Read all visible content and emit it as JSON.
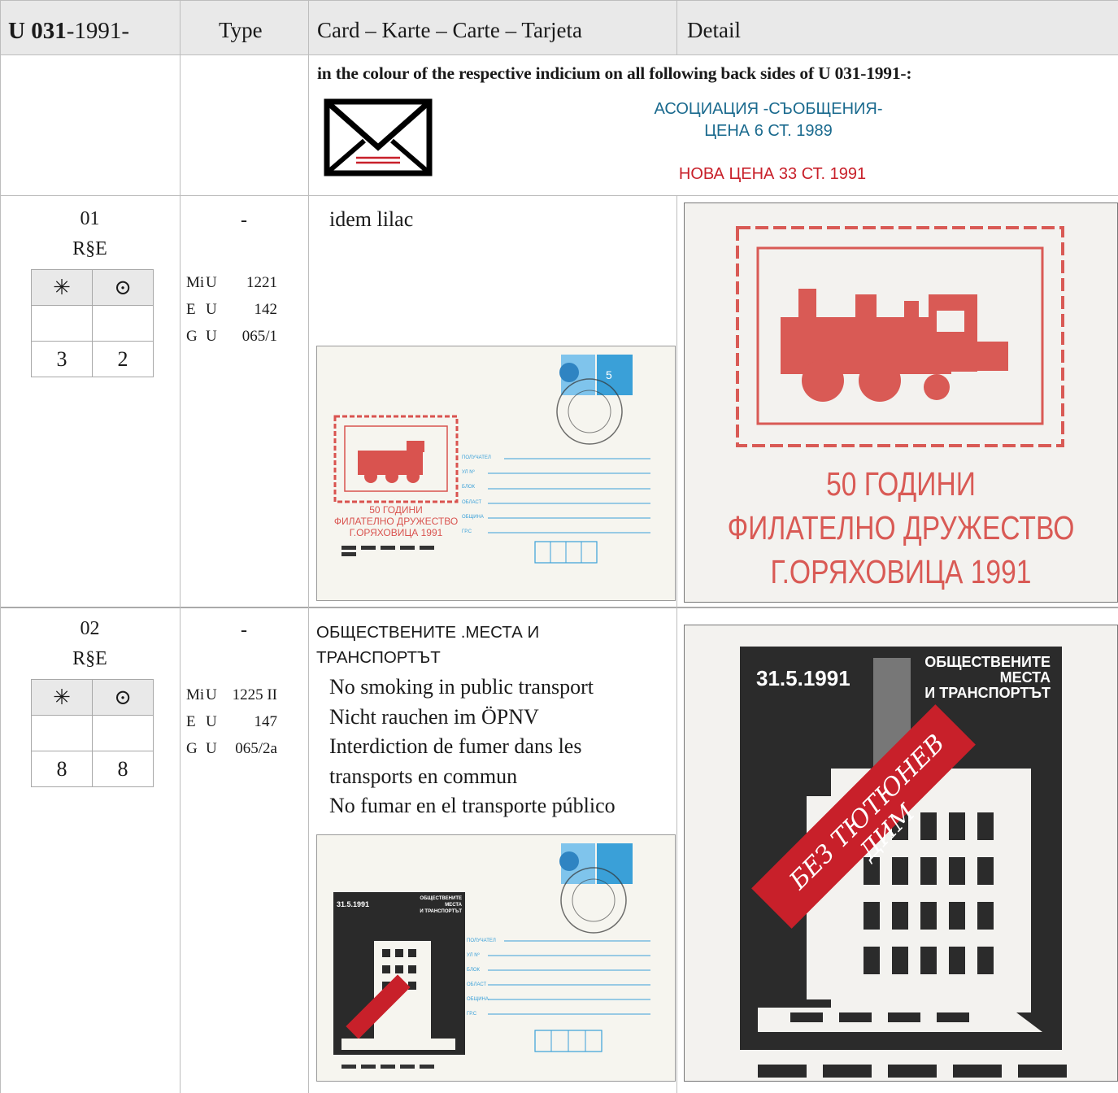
{
  "header": {
    "col1_bold": "U 031",
    "col1_rest": "-1991-",
    "col2": "Type",
    "col3": "Card – Karte – Carte – Tarjeta",
    "col4": "Detail"
  },
  "intro": {
    "note": "in the colour of the respective indicium on all following back sides of U 031-1991-:",
    "imprint_line1": "АСОЦИАЦИЯ -СЪОБЩЕНИЯ-",
    "imprint_line2": "ЦЕНА 6 СТ. 1989",
    "new_price": "НОВА ЦЕНА 33 СТ. 1991",
    "icon": "envelope-icon"
  },
  "rows": [
    {
      "number": "01",
      "code": "R§E",
      "symbols": [
        "✳",
        "⊙"
      ],
      "values": [
        "3",
        "2"
      ],
      "type": "-",
      "refs": [
        {
          "cat": "Mi",
          "l": "U",
          "n": "1221"
        },
        {
          "cat": "E",
          "l": "U",
          "n": "142"
        },
        {
          "cat": "G",
          "l": "U",
          "n": "065/1"
        }
      ],
      "desc": "idem lilac",
      "thumb": {
        "lines": [
          "50 ГОДИНИ",
          "ФИЛАТЕЛНО ДРУЖЕСТВО",
          "Г.ОРЯХОВИЦА  1991"
        ],
        "address_labels": [
          "ПОЛУЧАТЕЛ",
          "УЛ Nº",
          "БЛОК",
          "ОБЛАСТ",
          "ОБЩИНА",
          "ГР.С"
        ]
      },
      "detail": {
        "lines": [
          "50 ГОДИНИ",
          "ФИЛАТЕЛНО ДРУЖЕСТВО",
          "Г.ОРЯХОВИЦА  1991"
        ]
      }
    },
    {
      "number": "02",
      "code": "R§E",
      "symbols": [
        "✳",
        "⊙"
      ],
      "values": [
        "8",
        "8"
      ],
      "type": "-",
      "refs": [
        {
          "cat": "Mi",
          "l": "U",
          "n": "1225 II"
        },
        {
          "cat": "E",
          "l": "U",
          "n": "147"
        },
        {
          "cat": "G",
          "l": "U",
          "n": "065/2a"
        }
      ],
      "title_line1": "ОБЩЕСТВЕНИТЕ .МЕСТА И",
      "title_line2": "ТРАНСПОРТЪТ",
      "translations": [
        "No smoking in public transport",
        "Nicht rauchen im ÖPNV",
        "Interdiction de fumer dans les",
        "transports en commun",
        "No fumar en el transporte público"
      ],
      "thumb": {
        "date": "31.5.1991",
        "title": [
          "ОБЩЕСТВЕНИТЕ",
          "МЕСТА",
          "И ТРАНСПОРТЪТ"
        ],
        "address_labels": [
          "ПОЛУЧАТЕЛ",
          "УЛ Nº",
          "БЛОК",
          "ОБЛАСТ",
          "ОБЩИНА",
          "ГР.С"
        ]
      },
      "detail": {
        "date": "31.5.1991",
        "title": [
          "ОБЩЕСТВЕНИТЕ",
          "МЕСТА",
          "И ТРАНСПОРТЪТ"
        ],
        "banner": "БЕЗ ТЮТЮНЕВ ДИМ"
      }
    }
  ],
  "colors": {
    "imprint_blue": "#1a6a8e",
    "new_price_red": "#c8202a",
    "stamp_red": "#d9534f",
    "indicium_blue": "#3aa0d8"
  }
}
